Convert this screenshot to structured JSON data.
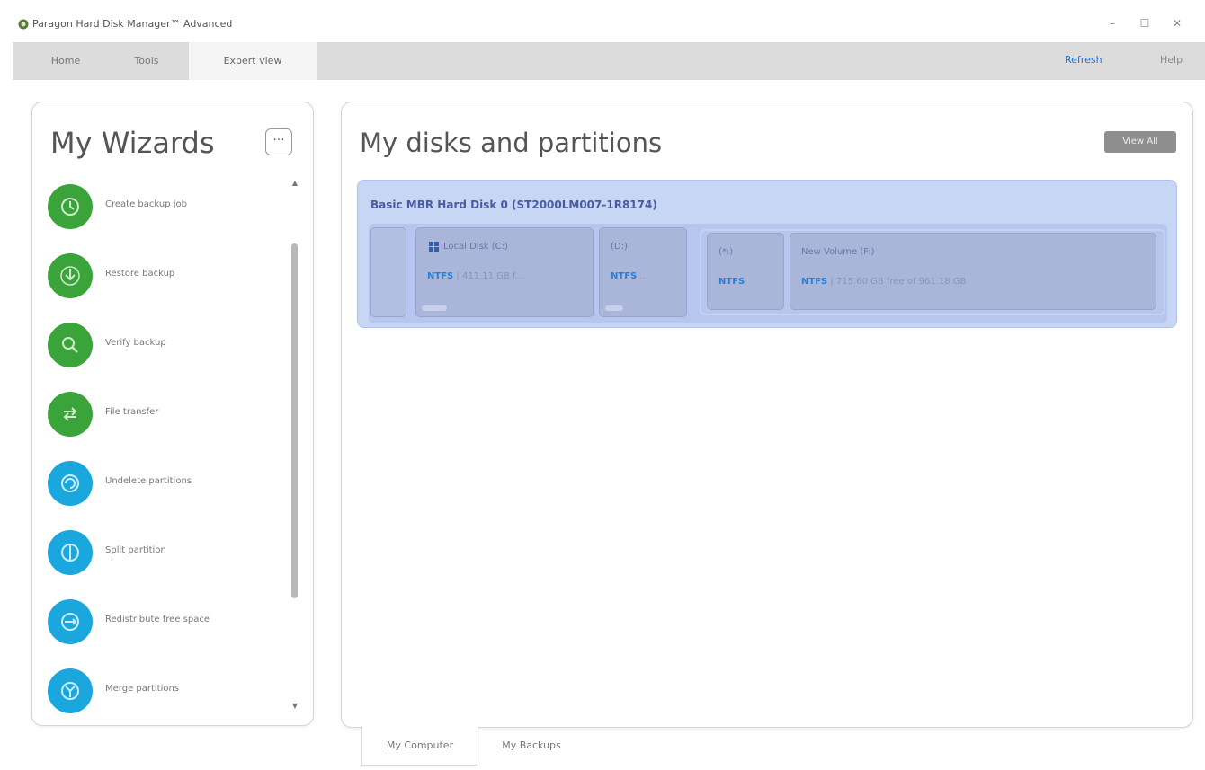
{
  "window": {
    "title": "Paragon Hard Disk Manager™ Advanced",
    "minimize": "–",
    "maximize": "☐",
    "close": "✕"
  },
  "tabs": [
    {
      "label": "Home"
    },
    {
      "label": "Tools"
    },
    {
      "label": "Expert view"
    }
  ],
  "top_links": {
    "refresh": "Refresh",
    "help": "Help"
  },
  "colors": {
    "link": "#1f6fd6",
    "wizard_green": "#3aa43a",
    "wizard_blue": "#1aa7dd",
    "disk_bg": "#c8d6f6",
    "fs_label": "#2a7fd0"
  },
  "wizards": {
    "title": "My Wizards",
    "more_label": "···",
    "items": [
      {
        "label": "Create backup job",
        "icon": "backup-icon",
        "color": "green"
      },
      {
        "label": "Restore backup",
        "icon": "restore-icon",
        "color": "green"
      },
      {
        "label": "Verify backup",
        "icon": "verify-icon",
        "color": "green"
      },
      {
        "label": "File transfer",
        "icon": "transfer-icon",
        "color": "green"
      },
      {
        "label": "Undelete partitions",
        "icon": "undelete-icon",
        "color": "blue"
      },
      {
        "label": "Split partition",
        "icon": "split-icon",
        "color": "blue"
      },
      {
        "label": "Redistribute free space",
        "icon": "redistribute-icon",
        "color": "blue"
      },
      {
        "label": "Merge partitions",
        "icon": "merge-icon",
        "color": "blue"
      }
    ]
  },
  "disks": {
    "title": "My disks and partitions",
    "view_button": "View All",
    "disk": {
      "name": "Basic MBR Hard Disk 0 (ST2000LM007-1R8174)",
      "partitions": [
        {
          "name": "Local Disk (C:)",
          "fs": "NTFS",
          "info": "| 411.11 GB f..."
        },
        {
          "name": "(D:)",
          "fs": "NTFS",
          "info": "..."
        },
        {
          "name": "(*:)",
          "fs": "NTFS",
          "info": ""
        },
        {
          "name": "New Volume (F:)",
          "fs": "NTFS",
          "info": "| 715.60 GB free of 961.18 GB"
        }
      ]
    }
  },
  "bottom_tabs": [
    {
      "label": "My Computer"
    },
    {
      "label": "My Backups"
    }
  ]
}
